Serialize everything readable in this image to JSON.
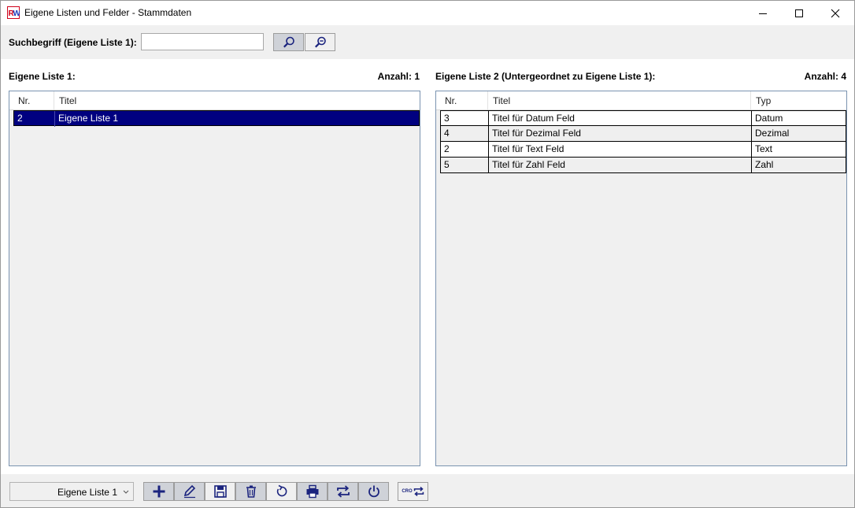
{
  "window": {
    "title": "Eigene Listen und Felder - Stammdaten",
    "app_icon": "rw-app-icon"
  },
  "search": {
    "label": "Suchbegriff (Eigene Liste 1):",
    "value": "",
    "placeholder": ""
  },
  "left_panel": {
    "title": "Eigene Liste 1:",
    "count": "Anzahl: 1",
    "columns": [
      "Nr.",
      "Titel"
    ],
    "rows": [
      {
        "nr": "2",
        "titel": "Eigene Liste 1"
      }
    ]
  },
  "right_panel": {
    "title": "Eigene Liste 2 (Untergeordnet zu Eigene Liste 1):",
    "count": "Anzahl: 4",
    "columns": [
      "Nr.",
      "Titel",
      "Typ"
    ],
    "rows": [
      {
        "nr": "3",
        "titel": "Titel für Datum Feld",
        "typ": "Datum"
      },
      {
        "nr": "4",
        "titel": "Titel für Dezimal Feld",
        "typ": "Dezimal"
      },
      {
        "nr": "2",
        "titel": "Titel für Text Feld",
        "typ": "Text"
      },
      {
        "nr": "5",
        "titel": "Titel für Zahl Feld",
        "typ": "Zahl"
      }
    ]
  },
  "toolbar": {
    "combo_value": "Eigene Liste 1",
    "buttons": [
      "add-icon",
      "edit-icon",
      "save-icon",
      "delete-icon",
      "refresh-icon",
      "print-icon",
      "switch-icon",
      "power-icon",
      "cro-switch-icon"
    ],
    "cro_label": "CRO"
  },
  "colors": {
    "accent": "#000080",
    "icon_blue": "#1a237e"
  }
}
